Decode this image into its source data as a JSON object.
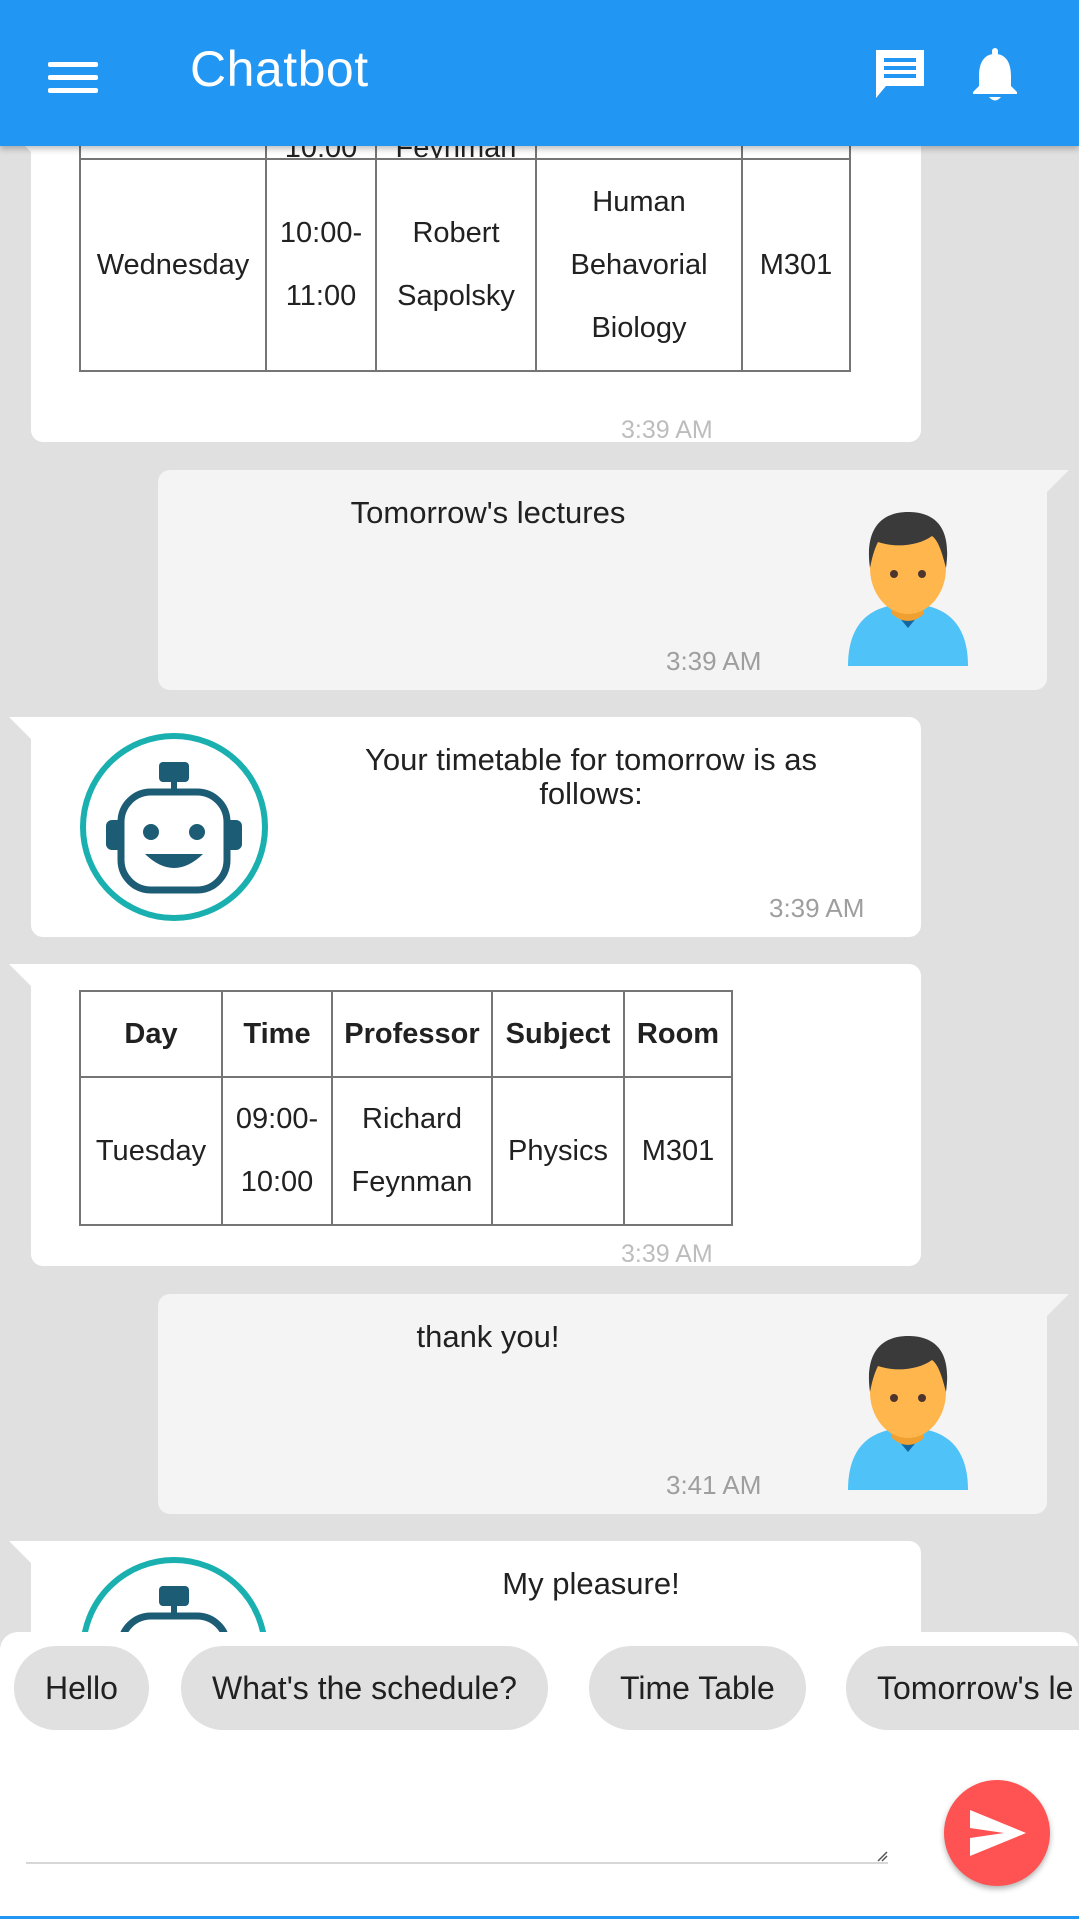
{
  "app": {
    "title": "Chatbot"
  },
  "colors": {
    "primary": "#2196f3",
    "send": "#ff5252",
    "bot_ring": "#1ab0b0",
    "bot_dark": "#1d5c75"
  },
  "icons": {
    "menu": "menu-icon",
    "chat": "chat-icon",
    "bell": "bell-icon",
    "send": "send-icon"
  },
  "messages": {
    "table1": {
      "partial_row": [
        "",
        "10:00",
        "Feynman",
        "",
        ""
      ],
      "row": {
        "day": "Wednesday",
        "time_a": "10:00-",
        "time_b": "11:00",
        "prof_a": "Robert",
        "prof_b": "Sapolsky",
        "subj_a": "Human",
        "subj_b": "Behavorial",
        "subj_c": "Biology",
        "room": "M301"
      },
      "time": "3:39 AM"
    },
    "user1": {
      "text": "Tomorrow's lectures",
      "time": "3:39 AM"
    },
    "bot1": {
      "text": "Your timetable for tomorrow is as follows:",
      "time": "3:39 AM"
    },
    "table2": {
      "headers": [
        "Day",
        "Time",
        "Professor",
        "Subject",
        "Room"
      ],
      "row": {
        "day": "Tuesday",
        "time_a": "09:00-",
        "time_b": "10:00",
        "prof_a": "Richard",
        "prof_b": "Feynman",
        "subject": "Physics",
        "room": "M301"
      },
      "time": "3:39 AM"
    },
    "user2": {
      "text": "thank you!",
      "time": "3:41 AM"
    },
    "bot2": {
      "text": "My pleasure!"
    }
  },
  "quick_replies": [
    "Hello",
    "What's the schedule?",
    "Time Table",
    "Tomorrow's le"
  ],
  "input": {
    "value": "",
    "placeholder": ""
  }
}
